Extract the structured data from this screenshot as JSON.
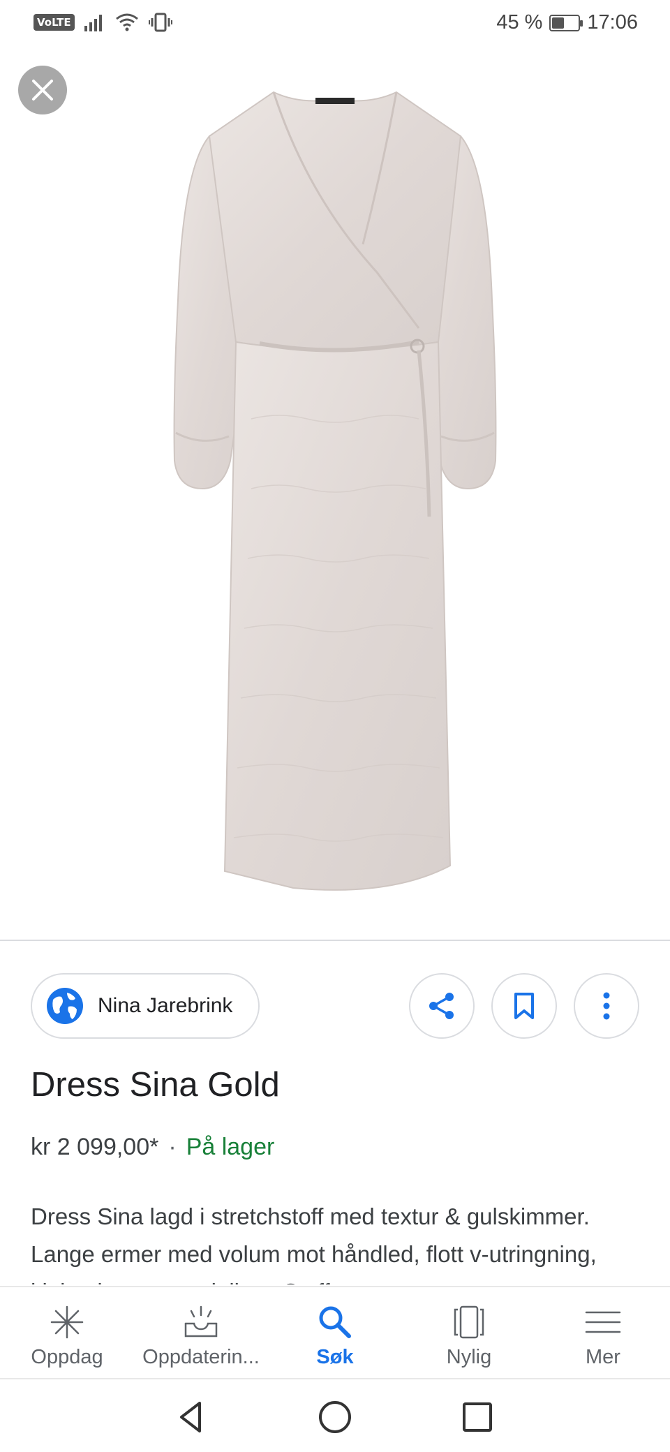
{
  "status_bar": {
    "network_badge": "VoLTE",
    "battery_percent": "45 %",
    "battery_level": 0.45,
    "time": "17:06",
    "icons": [
      "signal-icon",
      "wifi-icon",
      "vibrate-icon",
      "battery-icon"
    ]
  },
  "product": {
    "image_alt": "dress-image",
    "source": "Nina Jarebrink",
    "title": "Dress Sina Gold",
    "price": "kr 2 099,00*",
    "separator": "·",
    "stock": "På lager",
    "description": "Dress Sina lagd i stretchstoff med textur & gulskimmer. Lange ermer med volum mot håndled, flott v-utringning, kjolen knytes rundt livet. Stoffet er"
  },
  "actions": {
    "share": "share-icon",
    "save": "bookmark-icon",
    "more": "more-vert-icon"
  },
  "bottom_nav": [
    {
      "label": "Oppdag",
      "icon": "discover-icon",
      "active": false
    },
    {
      "label": "Oppdaterin...",
      "icon": "updates-icon",
      "active": false
    },
    {
      "label": "Søk",
      "icon": "search-icon",
      "active": true
    },
    {
      "label": "Nylig",
      "icon": "recent-icon",
      "active": false
    },
    {
      "label": "Mer",
      "icon": "menu-icon",
      "active": false
    }
  ],
  "colors": {
    "accent": "#1a73e8",
    "stock_green": "#188038",
    "dress": "#e3dcd9"
  }
}
